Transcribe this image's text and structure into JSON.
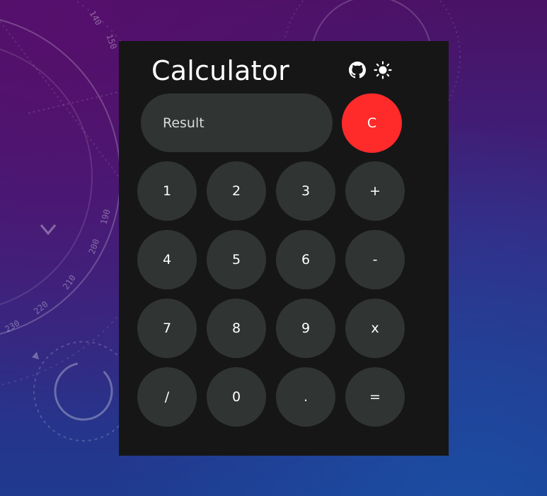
{
  "app": {
    "title": "Calculator"
  },
  "icons": {
    "github": "github-icon",
    "theme": "sun-icon"
  },
  "display": {
    "result_placeholder": "Result"
  },
  "buttons": {
    "clear": "C",
    "keys": [
      {
        "label": "1",
        "name": "key-1"
      },
      {
        "label": "2",
        "name": "key-2"
      },
      {
        "label": "3",
        "name": "key-3"
      },
      {
        "label": "+",
        "name": "key-plus"
      },
      {
        "label": "4",
        "name": "key-4"
      },
      {
        "label": "5",
        "name": "key-5"
      },
      {
        "label": "6",
        "name": "key-6"
      },
      {
        "label": "-",
        "name": "key-minus"
      },
      {
        "label": "7",
        "name": "key-7"
      },
      {
        "label": "8",
        "name": "key-8"
      },
      {
        "label": "9",
        "name": "key-9"
      },
      {
        "label": "x",
        "name": "key-multiply"
      },
      {
        "label": "/",
        "name": "key-divide"
      },
      {
        "label": "0",
        "name": "key-0"
      },
      {
        "label": ".",
        "name": "key-decimal"
      },
      {
        "label": "=",
        "name": "key-equals"
      }
    ]
  },
  "colors": {
    "panel": "#161616",
    "key": "#303432",
    "clear": "#ff2a2a",
    "text": "#ffffff"
  },
  "background": {
    "dial_numbers": [
      "140",
      "150",
      "190",
      "200",
      "210",
      "220",
      "230"
    ]
  }
}
